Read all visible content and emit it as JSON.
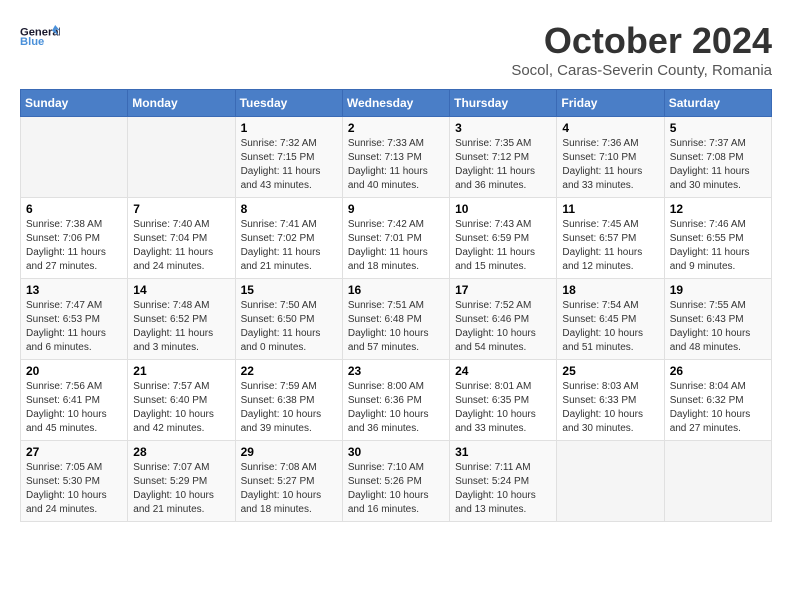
{
  "header": {
    "logo_general": "General",
    "logo_blue": "Blue",
    "month_title": "October 2024",
    "subtitle": "Socol, Caras-Severin County, Romania"
  },
  "weekdays": [
    "Sunday",
    "Monday",
    "Tuesday",
    "Wednesday",
    "Thursday",
    "Friday",
    "Saturday"
  ],
  "weeks": [
    [
      {
        "day": "",
        "sunrise": "",
        "sunset": "",
        "daylight": ""
      },
      {
        "day": "",
        "sunrise": "",
        "sunset": "",
        "daylight": ""
      },
      {
        "day": "1",
        "sunrise": "Sunrise: 7:32 AM",
        "sunset": "Sunset: 7:15 PM",
        "daylight": "Daylight: 11 hours and 43 minutes."
      },
      {
        "day": "2",
        "sunrise": "Sunrise: 7:33 AM",
        "sunset": "Sunset: 7:13 PM",
        "daylight": "Daylight: 11 hours and 40 minutes."
      },
      {
        "day": "3",
        "sunrise": "Sunrise: 7:35 AM",
        "sunset": "Sunset: 7:12 PM",
        "daylight": "Daylight: 11 hours and 36 minutes."
      },
      {
        "day": "4",
        "sunrise": "Sunrise: 7:36 AM",
        "sunset": "Sunset: 7:10 PM",
        "daylight": "Daylight: 11 hours and 33 minutes."
      },
      {
        "day": "5",
        "sunrise": "Sunrise: 7:37 AM",
        "sunset": "Sunset: 7:08 PM",
        "daylight": "Daylight: 11 hours and 30 minutes."
      }
    ],
    [
      {
        "day": "6",
        "sunrise": "Sunrise: 7:38 AM",
        "sunset": "Sunset: 7:06 PM",
        "daylight": "Daylight: 11 hours and 27 minutes."
      },
      {
        "day": "7",
        "sunrise": "Sunrise: 7:40 AM",
        "sunset": "Sunset: 7:04 PM",
        "daylight": "Daylight: 11 hours and 24 minutes."
      },
      {
        "day": "8",
        "sunrise": "Sunrise: 7:41 AM",
        "sunset": "Sunset: 7:02 PM",
        "daylight": "Daylight: 11 hours and 21 minutes."
      },
      {
        "day": "9",
        "sunrise": "Sunrise: 7:42 AM",
        "sunset": "Sunset: 7:01 PM",
        "daylight": "Daylight: 11 hours and 18 minutes."
      },
      {
        "day": "10",
        "sunrise": "Sunrise: 7:43 AM",
        "sunset": "Sunset: 6:59 PM",
        "daylight": "Daylight: 11 hours and 15 minutes."
      },
      {
        "day": "11",
        "sunrise": "Sunrise: 7:45 AM",
        "sunset": "Sunset: 6:57 PM",
        "daylight": "Daylight: 11 hours and 12 minutes."
      },
      {
        "day": "12",
        "sunrise": "Sunrise: 7:46 AM",
        "sunset": "Sunset: 6:55 PM",
        "daylight": "Daylight: 11 hours and 9 minutes."
      }
    ],
    [
      {
        "day": "13",
        "sunrise": "Sunrise: 7:47 AM",
        "sunset": "Sunset: 6:53 PM",
        "daylight": "Daylight: 11 hours and 6 minutes."
      },
      {
        "day": "14",
        "sunrise": "Sunrise: 7:48 AM",
        "sunset": "Sunset: 6:52 PM",
        "daylight": "Daylight: 11 hours and 3 minutes."
      },
      {
        "day": "15",
        "sunrise": "Sunrise: 7:50 AM",
        "sunset": "Sunset: 6:50 PM",
        "daylight": "Daylight: 11 hours and 0 minutes."
      },
      {
        "day": "16",
        "sunrise": "Sunrise: 7:51 AM",
        "sunset": "Sunset: 6:48 PM",
        "daylight": "Daylight: 10 hours and 57 minutes."
      },
      {
        "day": "17",
        "sunrise": "Sunrise: 7:52 AM",
        "sunset": "Sunset: 6:46 PM",
        "daylight": "Daylight: 10 hours and 54 minutes."
      },
      {
        "day": "18",
        "sunrise": "Sunrise: 7:54 AM",
        "sunset": "Sunset: 6:45 PM",
        "daylight": "Daylight: 10 hours and 51 minutes."
      },
      {
        "day": "19",
        "sunrise": "Sunrise: 7:55 AM",
        "sunset": "Sunset: 6:43 PM",
        "daylight": "Daylight: 10 hours and 48 minutes."
      }
    ],
    [
      {
        "day": "20",
        "sunrise": "Sunrise: 7:56 AM",
        "sunset": "Sunset: 6:41 PM",
        "daylight": "Daylight: 10 hours and 45 minutes."
      },
      {
        "day": "21",
        "sunrise": "Sunrise: 7:57 AM",
        "sunset": "Sunset: 6:40 PM",
        "daylight": "Daylight: 10 hours and 42 minutes."
      },
      {
        "day": "22",
        "sunrise": "Sunrise: 7:59 AM",
        "sunset": "Sunset: 6:38 PM",
        "daylight": "Daylight: 10 hours and 39 minutes."
      },
      {
        "day": "23",
        "sunrise": "Sunrise: 8:00 AM",
        "sunset": "Sunset: 6:36 PM",
        "daylight": "Daylight: 10 hours and 36 minutes."
      },
      {
        "day": "24",
        "sunrise": "Sunrise: 8:01 AM",
        "sunset": "Sunset: 6:35 PM",
        "daylight": "Daylight: 10 hours and 33 minutes."
      },
      {
        "day": "25",
        "sunrise": "Sunrise: 8:03 AM",
        "sunset": "Sunset: 6:33 PM",
        "daylight": "Daylight: 10 hours and 30 minutes."
      },
      {
        "day": "26",
        "sunrise": "Sunrise: 8:04 AM",
        "sunset": "Sunset: 6:32 PM",
        "daylight": "Daylight: 10 hours and 27 minutes."
      }
    ],
    [
      {
        "day": "27",
        "sunrise": "Sunrise: 7:05 AM",
        "sunset": "Sunset: 5:30 PM",
        "daylight": "Daylight: 10 hours and 24 minutes."
      },
      {
        "day": "28",
        "sunrise": "Sunrise: 7:07 AM",
        "sunset": "Sunset: 5:29 PM",
        "daylight": "Daylight: 10 hours and 21 minutes."
      },
      {
        "day": "29",
        "sunrise": "Sunrise: 7:08 AM",
        "sunset": "Sunset: 5:27 PM",
        "daylight": "Daylight: 10 hours and 18 minutes."
      },
      {
        "day": "30",
        "sunrise": "Sunrise: 7:10 AM",
        "sunset": "Sunset: 5:26 PM",
        "daylight": "Daylight: 10 hours and 16 minutes."
      },
      {
        "day": "31",
        "sunrise": "Sunrise: 7:11 AM",
        "sunset": "Sunset: 5:24 PM",
        "daylight": "Daylight: 10 hours and 13 minutes."
      },
      {
        "day": "",
        "sunrise": "",
        "sunset": "",
        "daylight": ""
      },
      {
        "day": "",
        "sunrise": "",
        "sunset": "",
        "daylight": ""
      }
    ]
  ]
}
